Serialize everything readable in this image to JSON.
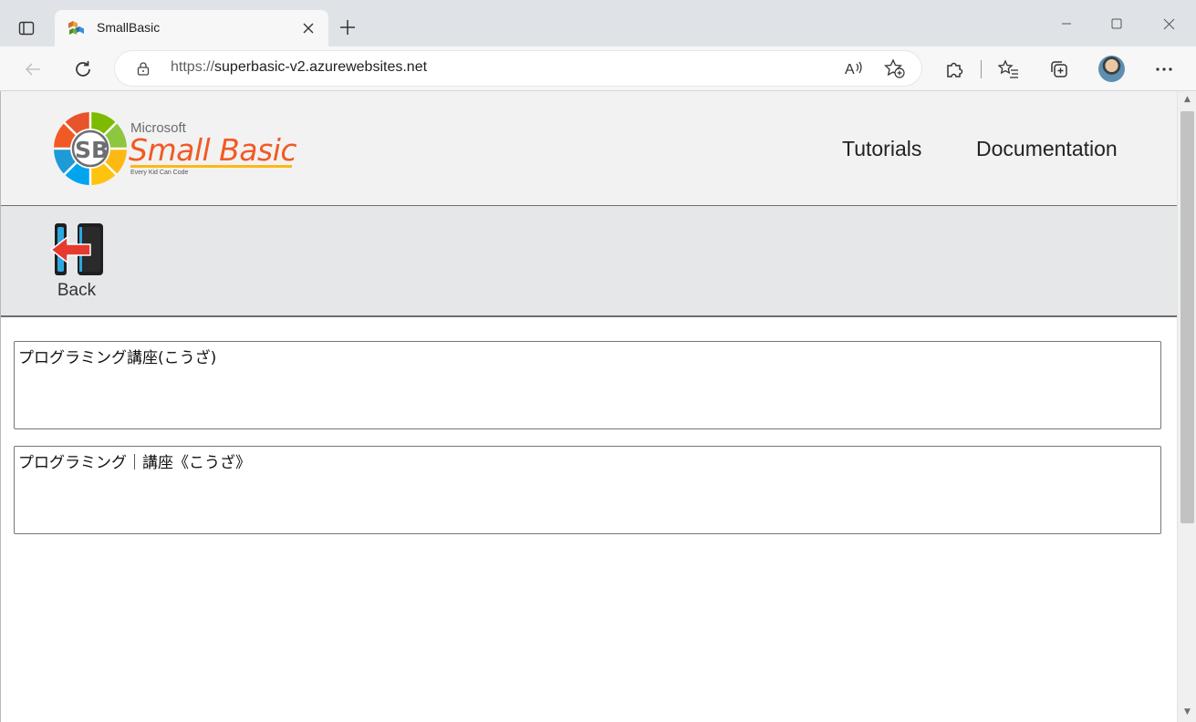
{
  "browser": {
    "tab_title": "SmallBasic",
    "url_scheme": "https://",
    "url_host": "superbasic-v2.azurewebsites.net"
  },
  "icons": {
    "tab_actions": "tab-actions-icon",
    "favicon": "smallbasic-favicon",
    "close": "close-icon",
    "new_tab": "plus-icon",
    "minimize": "minimize-icon",
    "maximize": "maximize-icon",
    "window_close": "close-icon",
    "back": "back-arrow-icon",
    "refresh": "refresh-icon",
    "lock": "lock-icon",
    "read_aloud": "read-aloud-icon",
    "add_favorite": "star-plus-icon",
    "extensions": "puzzle-icon",
    "favorites": "favorites-list-icon",
    "collections": "collections-icon",
    "more": "more-dots-icon"
  },
  "site": {
    "logo": {
      "brand": "Microsoft",
      "name": "Small Basic",
      "tagline": "Every Kid Can Code"
    },
    "nav": [
      {
        "label": "Tutorials"
      },
      {
        "label": "Documentation"
      }
    ],
    "back_label": "Back"
  },
  "content": {
    "input_text": "プログラミング講座(こうざ)",
    "output_text": "プログラミング｜講座《こうざ》"
  },
  "colors": {
    "logo_orange": "#f15a24",
    "logo_yellow": "#fdb913",
    "logo_green": "#7cbb00",
    "logo_blue": "#00a4ef",
    "back_arrow_red": "#e63a2e"
  }
}
